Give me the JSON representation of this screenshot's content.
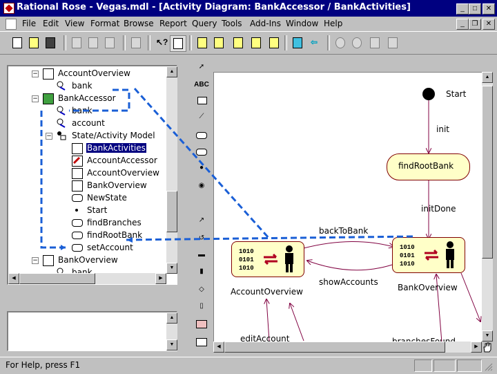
{
  "window": {
    "title": "Rational Rose - Vegas.mdl - [Activity Diagram: BankAccessor / BankActivities]"
  },
  "menu": [
    "File",
    "Edit",
    "View",
    "Format",
    "Browse",
    "Report",
    "Query",
    "Tools",
    "Add-Ins",
    "Window",
    "Help"
  ],
  "toolbar": {
    "icons": [
      "new-icon",
      "open-icon",
      "save-icon",
      "cut-icon",
      "copy-icon",
      "paste-icon",
      "print-icon",
      "context-help-icon",
      "view-doc-icon",
      "browse-class-diagram-icon",
      "browse-interaction-diagram-icon",
      "browse-component-diagram-icon",
      "browse-state-diagram-icon",
      "browse-deployment-diagram-icon",
      "browse-parent-icon",
      "browse-previous-icon",
      "zoom-in-icon",
      "zoom-out-icon",
      "fit-in-window-icon",
      "undo-fit-icon"
    ]
  },
  "browser": {
    "items": [
      {
        "label": "AccountOverview",
        "icon": "actor-diagram-icon"
      },
      {
        "label": "bank",
        "icon": "association-icon"
      },
      {
        "label": "BankAccessor",
        "icon": "actor-icon"
      },
      {
        "label": "bank",
        "icon": "association-icon"
      },
      {
        "label": "account",
        "icon": "association-icon"
      },
      {
        "label": "State/Activity Model",
        "icon": "state-model-icon"
      },
      {
        "label": "BankActivities",
        "icon": "activity-diagram-icon"
      },
      {
        "label": "AccountAccessor",
        "icon": "actor-diagram-icon"
      },
      {
        "label": "AccountOverview",
        "icon": "actor-diagram-icon"
      },
      {
        "label": "BankOverview",
        "icon": "actor-diagram-icon"
      },
      {
        "label": "NewState",
        "icon": "state-icon"
      },
      {
        "label": "Start",
        "icon": "start-icon"
      },
      {
        "label": "findBranches",
        "icon": "activity-icon"
      },
      {
        "label": "findRootBank",
        "icon": "activity-icon"
      },
      {
        "label": "setAccount",
        "icon": "activity-icon"
      },
      {
        "label": "BankOverview",
        "icon": "actor-diagram-icon"
      },
      {
        "label": "bank",
        "icon": "association-icon"
      }
    ]
  },
  "palette": {
    "tools": [
      "selection-arrow-icon",
      "text-box-icon",
      "note-icon",
      "anchor-note-icon",
      "state-icon",
      "activity-icon",
      "start-state-icon",
      "end-state-icon",
      "state-transition-icon",
      "transition-to-self-icon",
      "horizontal-sync-icon",
      "vertical-sync-icon",
      "decision-icon",
      "swimlane-icon",
      "object-icon",
      "object-flow-icon"
    ],
    "text_tool": "ABC"
  },
  "diagram": {
    "start_label": "Start",
    "init_label": "init",
    "findRootBank_label": "findRootBank",
    "initDone_label": "initDone",
    "backToBank_label": "backToBank",
    "showAccounts_label": "showAccounts",
    "accountOverview_label": "AccountOverview",
    "bankOverview_label": "BankOverview",
    "editAccount_label": "editAccount",
    "branchesFound_label": "branchesFound",
    "binary": "1010\n0101\n1010"
  },
  "status": {
    "help_text": "For Help, press F1"
  },
  "colors": {
    "titlebar": "#000080",
    "activity_fill": "#ffffc8",
    "activity_border": "#800000",
    "annotation_blue": "#1a5fd6",
    "flow_line": "#800040"
  }
}
